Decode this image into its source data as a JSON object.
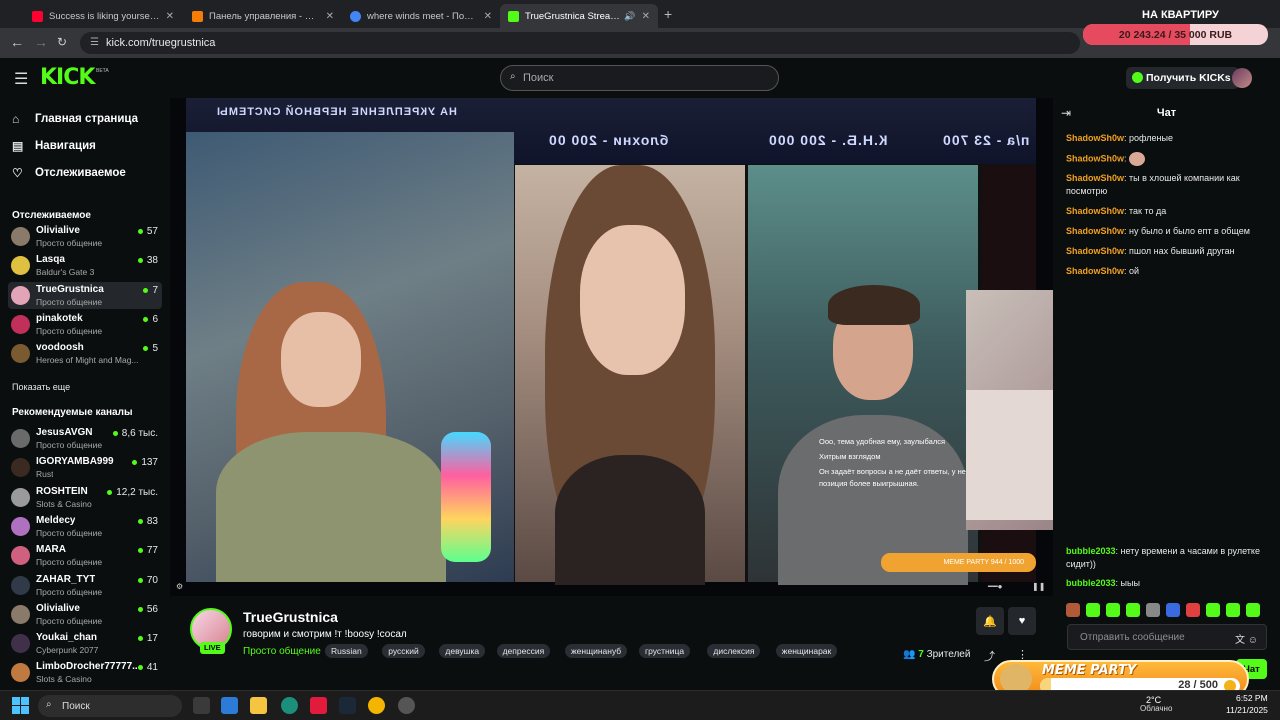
{
  "browser": {
    "tabs": [
      {
        "title": "Success is liking yourself, liking",
        "color": "#ff0033"
      },
      {
        "title": "Панель управления - Donation",
        "color": "#f57d07"
      },
      {
        "title": "where winds meet - Поиск в Go",
        "color": "#4285f4"
      },
      {
        "title": "TrueGrustnica Stream - Wa",
        "color": "#53fc18"
      }
    ],
    "url": "kick.com/truegrustnica"
  },
  "donation_goal": {
    "title": "НА КВАРТИРУ",
    "progress_text": "20 243.24 / 35 000 RUB",
    "progress_fraction": 0.578
  },
  "header": {
    "logo": "KICK",
    "logo_badge": "BETA",
    "search_placeholder": "Поиск",
    "get_kicks_label": "Получить KICKs"
  },
  "sidebar": {
    "nav": [
      {
        "label": "Главная страница",
        "icon": "home-icon"
      },
      {
        "label": "Навигация",
        "icon": "browse-icon"
      },
      {
        "label": "Отслеживаемое",
        "icon": "heart-icon"
      }
    ],
    "following_title": "Отслеживаемое",
    "following": [
      {
        "name": "Olivialive",
        "category": "Просто общение",
        "viewers": "57",
        "color": "#8a7a6a"
      },
      {
        "name": "Lasqa",
        "category": "Baldur's Gate 3",
        "viewers": "38",
        "color": "#e0c040"
      },
      {
        "name": "TrueGrustnica",
        "category": "Просто общение",
        "viewers": "7",
        "color": "#e3a4b8"
      },
      {
        "name": "pinakotek",
        "category": "Просто общение",
        "viewers": "6",
        "color": "#c0305a"
      },
      {
        "name": "voodoosh",
        "category": "Heroes of Might and Mag...",
        "viewers": "5",
        "color": "#7a5a30"
      }
    ],
    "show_more": "Показать еще",
    "recommended_title": "Рекомендуемые каналы",
    "recommended": [
      {
        "name": "JesusAVGN",
        "category": "Просто общение",
        "viewers": "8,6 тыс.",
        "color": "#6a6a6a"
      },
      {
        "name": "IGORYAMBA999",
        "category": "Rust",
        "viewers": "137",
        "color": "#3a2a20"
      },
      {
        "name": "ROSHTEIN",
        "category": "Slots & Casino",
        "viewers": "12,2 тыс.",
        "color": "#9a9a9a"
      },
      {
        "name": "Meldecy",
        "category": "Просто общение",
        "viewers": "83",
        "color": "#b070c0"
      },
      {
        "name": "MARA",
        "category": "Просто общение",
        "viewers": "77",
        "color": "#d06080"
      },
      {
        "name": "ZAHAR_TYT",
        "category": "Просто общение",
        "viewers": "70",
        "color": "#303a48"
      },
      {
        "name": "Olivialive",
        "category": "Просто общение",
        "viewers": "56",
        "color": "#8a7a6a"
      },
      {
        "name": "Youkai_chan",
        "category": "Cyberpunk 2077",
        "viewers": "17",
        "color": "#40304a"
      },
      {
        "name": "LimboDrocher77777...",
        "category": "Slots & Casino",
        "viewers": "41",
        "color": "#c07a40"
      }
    ]
  },
  "video": {
    "banner_left": "НА УКРЕПЛЕНИЕ НЕРВНОЙ СИСТЕМЫ",
    "banner_mid": "блохни - 200 00",
    "banner_mid2": "К.Н.Б. - 200 000",
    "banner_right": "п/а - 23 700",
    "overlay_messages": [
      "Ооо, тема удобная ему, заулыбался",
      "Хитрым взглядом",
      "Он задаёт вопросы а не даёт ответы, у него позиция более выигрышная."
    ],
    "meme_mini": "MEME PARTY 944 / 1000"
  },
  "stream": {
    "channel": "TrueGrustnica",
    "live": "LIVE",
    "title": "говорим и смотрим !т !boosy !сосал",
    "category": "Просто общение",
    "tags": [
      "Russian",
      "русский",
      "девушка",
      "депрессия",
      "женщинануб",
      "грустница",
      "дислексия",
      "женщинарак"
    ],
    "viewers_count": "7",
    "viewers_label": "Зрителей"
  },
  "chat": {
    "title": "Чат",
    "messages": [
      {
        "user": "ShadowSh0w",
        "text": "рофленые",
        "color": "#f0a020"
      },
      {
        "user": "ShadowSh0w",
        "text": "",
        "color": "#f0a020"
      },
      {
        "user": "ShadowSh0w",
        "text": "ты в хлошей компании как посмотрю",
        "color": "#f0a020"
      },
      {
        "user": "ShadowSh0w",
        "text": "так то да",
        "color": "#f0a020"
      },
      {
        "user": "ShadowSh0w",
        "text": "ну было и было епт в общем",
        "color": "#f0a020"
      },
      {
        "user": "ShadowSh0w",
        "text": "пшол нах бывший друган",
        "color": "#f0a020"
      },
      {
        "user": "ShadowSh0w",
        "text": "ой",
        "color": "#f0a020"
      },
      {
        "user": "bubble2033",
        "text": "нету времени а часами в рулетке сидит))",
        "color": "#53fc18"
      },
      {
        "user": "bubble2033",
        "text": "ыыы",
        "color": "#53fc18"
      }
    ],
    "input_placeholder": "Отправить сообщение",
    "send_label": "Чат"
  },
  "meme_party": {
    "title": "MEME PARTY",
    "count": "28 / 500",
    "progress_fraction": 0.056
  },
  "taskbar": {
    "search_label": "Поиск",
    "temperature": "2°C",
    "weather": "Облачно",
    "time": "6:52 PM",
    "date": "11/21/2025"
  }
}
